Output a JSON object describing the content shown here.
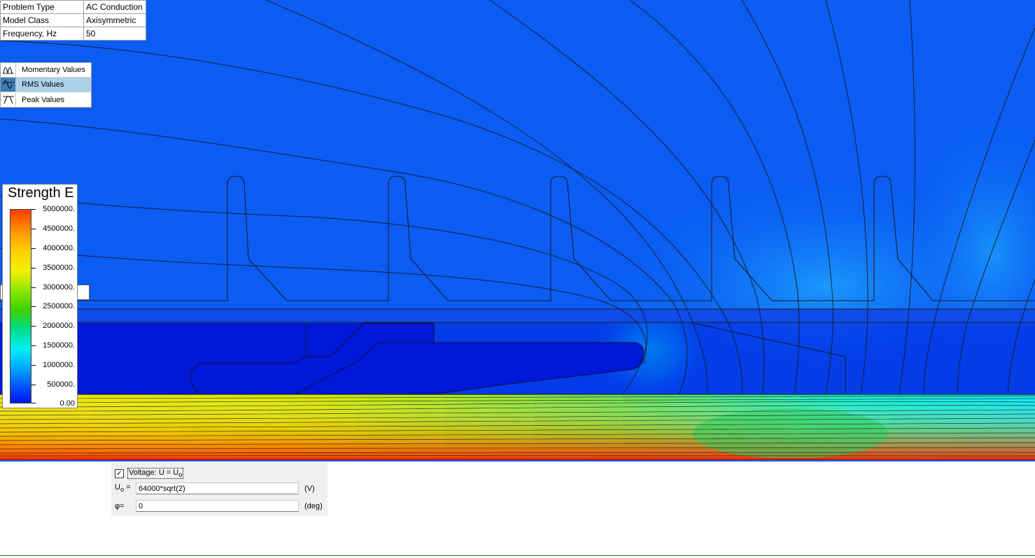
{
  "problem_info": [
    {
      "key": "Problem Type",
      "value": "AC Conduction"
    },
    {
      "key": "Model Class",
      "value": "Axisymmetric"
    },
    {
      "key": "Frequency, Hz",
      "value": "50"
    }
  ],
  "display_modes": [
    {
      "label": "Momentary Values",
      "icon": "momentary-wave-icon",
      "selected": false
    },
    {
      "label": "RMS Values",
      "icon": "rms-wave-icon",
      "selected": true
    },
    {
      "label": "Peak Values",
      "icon": "peak-wave-icon",
      "selected": false
    }
  ],
  "legend": {
    "title": "Strength E",
    "labels": [
      "5000000.",
      "4500000.",
      "4000000.",
      "3500000.",
      "3000000.",
      "2500000.",
      "2000000.",
      "1500000.",
      "1000000.",
      "500000.",
      "0.00"
    ]
  },
  "boundary_condition": {
    "checkbox_mark": "✓",
    "voltage_label": "Voltage: U = U",
    "voltage_sub": "o",
    "uo_label": "U",
    "uo_sub": "o",
    "uo_eq": " =",
    "uo_value": "64000*sqrt(2)",
    "uo_unit": "(V)",
    "phi_label": "φ=",
    "phi_value": "0",
    "phi_unit": "(deg)"
  },
  "colors": {
    "field_background": "#0a5cf2",
    "conductor": "#0018d8",
    "equipotential": "#1a1a1a"
  }
}
